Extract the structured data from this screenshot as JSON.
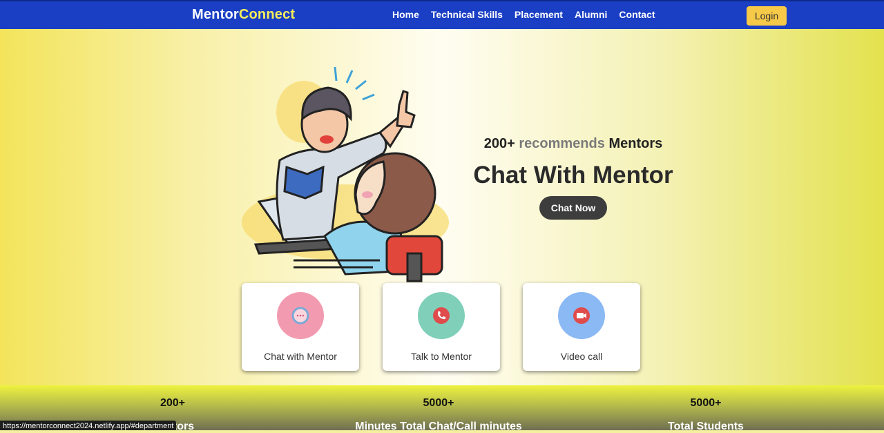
{
  "brand": {
    "part1": "Mentor",
    "part2": "Connect"
  },
  "nav": {
    "links": [
      "Home",
      "Technical Skills",
      "Placement",
      "Alumni",
      "Contact"
    ],
    "login": "Login"
  },
  "hero": {
    "sub_count": "200+",
    "sub_mid": "recommends",
    "sub_end": "Mentors",
    "title": "Chat With Mentor",
    "button": "Chat Now"
  },
  "cards": [
    {
      "label": "Chat with Mentor",
      "icon": "chat-bubble-icon",
      "color": "#f29bb0"
    },
    {
      "label": "Talk to Mentor",
      "icon": "phone-icon",
      "color": "#7fcfb9"
    },
    {
      "label": "Video call",
      "icon": "video-camera-icon",
      "color": "#8ab9f4"
    }
  ],
  "stats": [
    {
      "num": "200+",
      "cap": "Mentors"
    },
    {
      "num": "5000+",
      "cap": "Minutes Total Chat/Call minutes"
    },
    {
      "num": "5000+",
      "cap": "Total Students"
    }
  ],
  "statusbar": "https://mentorconnect2024.netlify.app/#department",
  "colors": {
    "nav": "#1a3fc4",
    "login": "#f7c948",
    "brand_accent": "#f7ef5a"
  }
}
